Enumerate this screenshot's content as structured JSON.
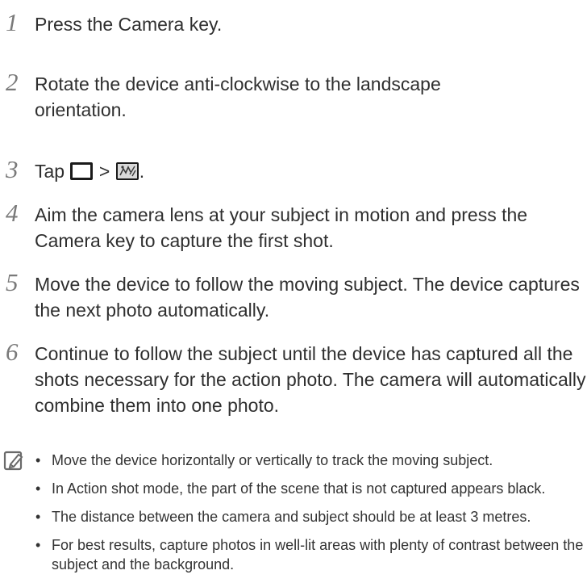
{
  "steps": [
    {
      "num": "1",
      "text": "Press the Camera key."
    },
    {
      "num": "2",
      "text": "Rotate the device anti-clockwise to the landscape orientation."
    },
    {
      "num": "3",
      "text_before": "Tap",
      "text_between": ">",
      "text_after": "."
    },
    {
      "num": "4",
      "text": "Aim the camera lens at your subject in motion and press the Camera key to capture the first shot."
    },
    {
      "num": "5",
      "text": "Move the device to follow the moving subject. The device captures the next photo automatically."
    },
    {
      "num": "6",
      "text": "Continue to follow the subject until the device has captured all the shots necessary for the action photo. The camera will automatically combine them into one photo."
    }
  ],
  "notes": [
    "Move the device horizontally or vertically to track the moving subject.",
    "In Action shot mode, the part of the scene that is not captured appears black.",
    "The distance between the camera and subject should be at least 3 metres.",
    "For best results, capture photos in well-lit areas with plenty of contrast between the subject and the background."
  ],
  "icons": {
    "mode_icon": "shooting-mode-icon",
    "action_icon": "action-shot-icon",
    "note_icon": "note-pencil-icon"
  },
  "colors": {
    "step_number": "#7a7a7a",
    "body_text": "#2f2f2f",
    "icon_stroke": "#1a1a1a"
  }
}
